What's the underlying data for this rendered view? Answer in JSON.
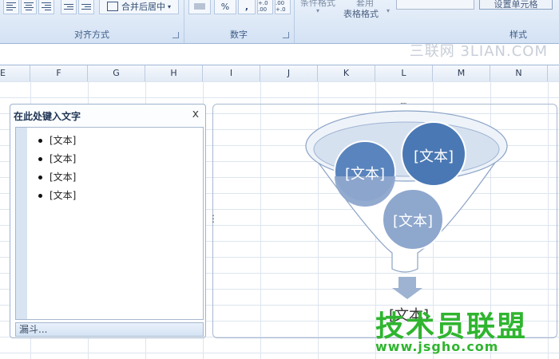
{
  "ribbon": {
    "merge_label": "合并后居中",
    "align_group_label": "对齐方式",
    "number_group_label": "数字",
    "style_group_label": "样式",
    "cond_format_label": "条件格式",
    "table_format_label_1": "套用",
    "table_format_label_2": "表格格式",
    "percent_label": "%",
    "comma_label": ",",
    "inc_decimal_label": "+.0 .00",
    "dec_decimal_label": ".00 +.0",
    "style_box_label": "设置单元格"
  },
  "watermark_top": "三联网 3LIAN.COM",
  "columns": [
    "E",
    "F",
    "G",
    "H",
    "I",
    "J",
    "K",
    "L",
    "M",
    "N"
  ],
  "text_pane": {
    "title": "在此处键入文字",
    "close_glyph": "x",
    "items": [
      "[文本]",
      "[文本]",
      "[文本]",
      "[文本]"
    ],
    "footer": "漏斗..."
  },
  "smartart": {
    "circle_1": "[文本]",
    "circle_2": "[文本]",
    "circle_3": "[文本]",
    "bottom_text": "[文本]",
    "handle_top": "....",
    "handle_left": "⋮"
  },
  "watermark_bottom_1": "技术员联盟",
  "watermark_bottom_2": "www.jsgho.com",
  "colors": {
    "circle_dark": "#4a78b4",
    "circle_light": "#8ea7cd",
    "funnel_stroke": "#8ba3c5",
    "arrow": "#9eb3d1",
    "watermark_green": "#2fb52f"
  }
}
